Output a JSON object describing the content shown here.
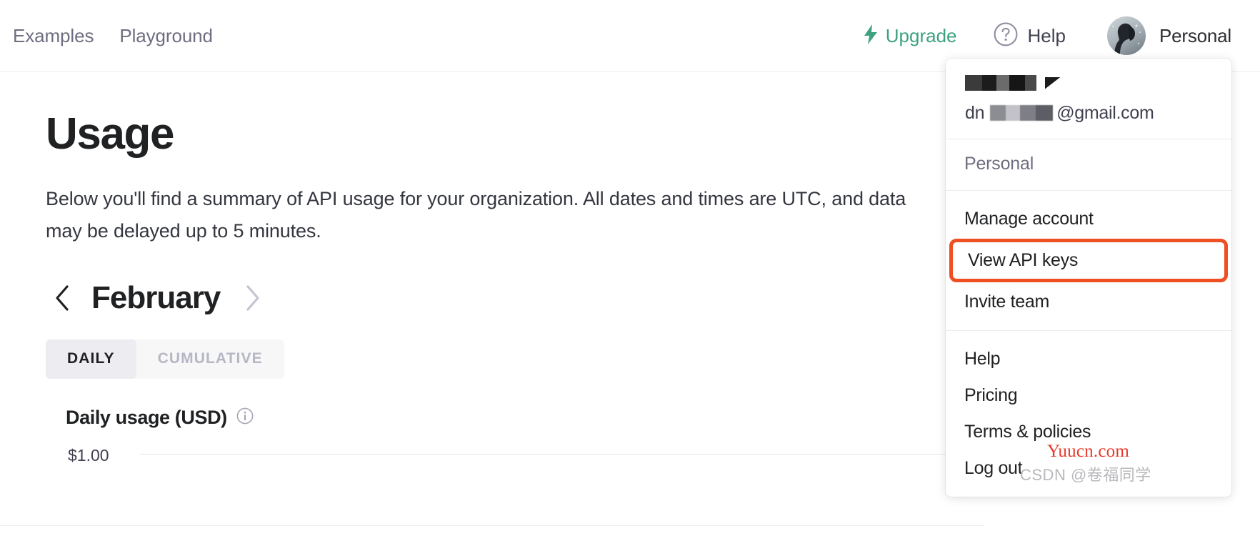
{
  "topnav": {
    "links": [
      {
        "label": "Examples",
        "name": "nav-link-examples"
      },
      {
        "label": "Playground",
        "name": "nav-link-playground"
      }
    ],
    "upgrade_label": "Upgrade",
    "upgrade_icon": "lightning-bolt-icon",
    "upgrade_color": "#3fa27f",
    "help_label": "Help",
    "help_icon": "question-circle-icon",
    "account_label": "Personal",
    "avatar_icon": "user-avatar-image"
  },
  "main": {
    "title": "Usage",
    "description": "Below you'll find a summary of API usage for your organization. All dates and times are UTC, and data may be delayed up to 5 minutes.",
    "month_nav": {
      "prev_icon": "chevron-left-icon",
      "next_icon": "chevron-right-icon",
      "month": "February"
    },
    "tabs": [
      {
        "label": "DAILY",
        "active": true
      },
      {
        "label": "CUMULATIVE",
        "active": false
      }
    ],
    "chart": {
      "title": "Daily usage (USD)",
      "info_icon": "info-circle-icon",
      "y_ticks": [
        "$1.00"
      ]
    }
  },
  "dropdown": {
    "account_name_redacted": "",
    "email_suffix": "@gmail.com",
    "email_prefix": "dn",
    "org_label": "Personal",
    "group_account": [
      {
        "label": "Manage account",
        "highlighted": false
      },
      {
        "label": "View API keys",
        "highlighted": true
      },
      {
        "label": "Invite team",
        "highlighted": false
      }
    ],
    "group_links": [
      {
        "label": "Help",
        "highlighted": false
      },
      {
        "label": "Pricing",
        "highlighted": false
      },
      {
        "label": "Terms & policies",
        "highlighted": false
      },
      {
        "label": "Log out",
        "highlighted": false
      }
    ],
    "highlight_color": "#ef4f22"
  },
  "watermarks": {
    "yuucn": "Yuucn.com",
    "csdn": "CSDN @卷福同学"
  },
  "chart_data": {
    "type": "bar",
    "title": "Daily usage (USD)",
    "categories": [],
    "values": [],
    "ylabel": "",
    "xlabel": "",
    "ytick_labels": [
      "$1.00"
    ],
    "ylim": [
      0,
      1.0
    ],
    "grid": true,
    "note": "Chart body is cut off at the bottom of the screenshot; only the $1.00 gridline is visible."
  }
}
